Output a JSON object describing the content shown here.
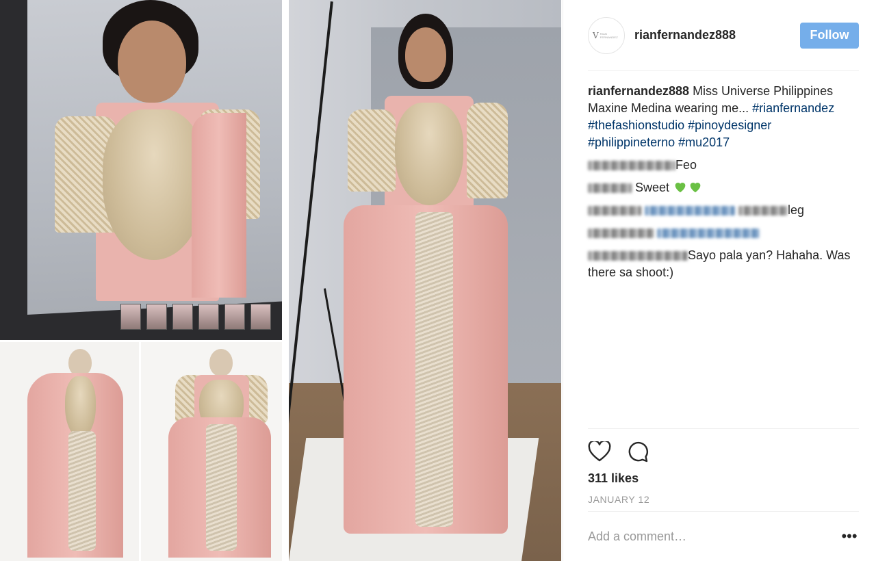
{
  "post": {
    "username": "rianfernandez888",
    "follow_label": "Follow",
    "caption": {
      "username": "rianfernandez888",
      "text": " Miss Universe Philippines Maxine Medina wearing me... ",
      "hashtags": [
        "#rianfernandez",
        "#thefashionstudio",
        "#pinoydesigner",
        "#philippineterno",
        "#mu2017"
      ]
    },
    "comments": [
      {
        "text": "Feo"
      },
      {
        "text": "Sweet "
      },
      {
        "text": "leg"
      },
      {
        "text": ""
      },
      {
        "text": "Sayo pala yan? Hahaha. Was there sa shoot:)"
      }
    ],
    "likes": "311 likes",
    "date": "JANUARY 12",
    "comment_placeholder": "Add a comment…",
    "more_label": "•••"
  },
  "icons": {
    "like": "heart-icon",
    "comment": "comment-bubble-icon",
    "emoji": "green-heart-emoji",
    "more": "more-options-icon"
  },
  "colors": {
    "follow_button": "#75aeea",
    "hashtag": "#003569",
    "secondary_text": "#999999",
    "divider": "#efefef",
    "green_heart": "#6ac044"
  }
}
